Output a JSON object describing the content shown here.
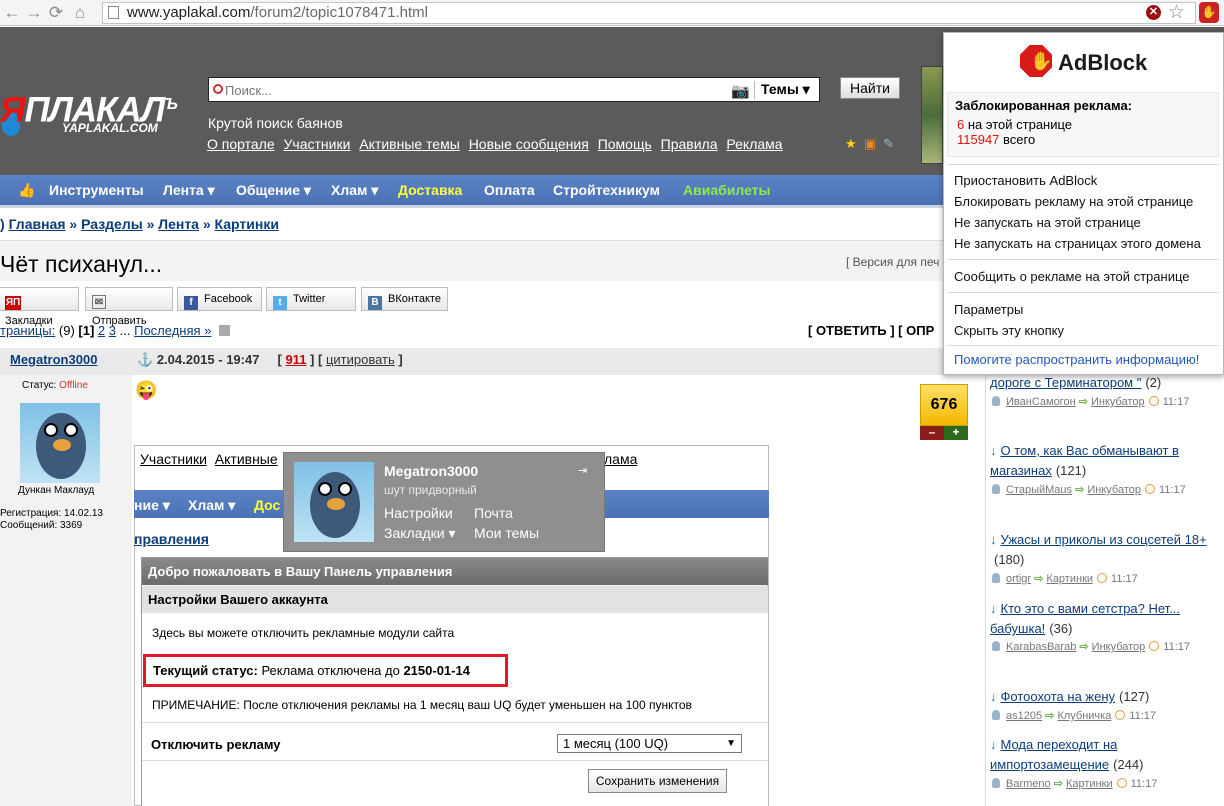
{
  "browser": {
    "url_host": "www.yaplakal.com",
    "url_path": "/forum2/topic1078471.html"
  },
  "site": {
    "logo_text_red": "Я",
    "logo_text": "ПЛАКАЛ",
    "logo_sup": "Ъ",
    "logo_sub": "YAPLAKAL.COM",
    "search_placeholder": "Поиск...",
    "search_scope": "Темы",
    "search_button": "Найти",
    "tagline": "Крутой поиск баянов",
    "top_links": [
      "О портале",
      "Участники",
      "Активные темы",
      "Новые сообщения",
      "Помощь",
      "Правила",
      "Реклама"
    ],
    "menu": [
      {
        "label": "Инструменты",
        "color": "#ffffff"
      },
      {
        "label": "Лента ▾",
        "color": "#ffffff"
      },
      {
        "label": "Общение ▾",
        "color": "#ffffff"
      },
      {
        "label": "Хлам ▾",
        "color": "#ffffff"
      },
      {
        "label": "Доставка",
        "color": "#ffff3a"
      },
      {
        "label": "Оплата",
        "color": "#ffffff"
      },
      {
        "label": "Стройтехникум",
        "color": "#ffffff"
      },
      {
        "label": "Авиабилеты",
        "color": "#8eea48"
      }
    ]
  },
  "breadcrumb": {
    "items": [
      "Главная",
      "Разделы",
      "Лента",
      "Картинки"
    ],
    "sep": "»"
  },
  "topic": {
    "title": "Чёт психанул...",
    "print_version": "[ Версия для печ",
    "share": [
      "Закладки",
      "Отправить",
      "Facebook",
      "Twitter",
      "ВКонтакте"
    ],
    "pages_label": "траницы:",
    "pages_count": "(9)",
    "pages_current": "[1]",
    "page_2": "2",
    "page_3": "3",
    "pages_ellipsis": "...",
    "pages_last": "Последняя »",
    "reply": "[ ОТВЕТИТЬ ] [ ОПР"
  },
  "post": {
    "author": "Megatron3000",
    "anchor_icon": "⚓",
    "date": "2.04.2015 - 19:47",
    "number": "911",
    "quote": "цитировать",
    "status_label": "Статус:",
    "status_value": "Offline",
    "user_title": "Дункан Маклауд",
    "reg": "Регистрация: 14.02.13",
    "msgs": "Сообщений: 3369",
    "uq": "676",
    "uq_minus": "–",
    "uq_plus": "+"
  },
  "embedded": {
    "links": [
      "Участники",
      "Активные"
    ],
    "links_tail": "лама",
    "menu": [
      "ние ▾",
      "Хлам ▾",
      "Дос"
    ],
    "crumb": "правления",
    "cp_title": "Добро пожаловать в Вашу Панель управления",
    "cp_sub": "Настройки Вашего аккаунта",
    "cp_desc": "Здесь вы можете отключить рекламные модули сайта",
    "status_label": "Текущий статус:",
    "status_text": "Реклама отключена до",
    "status_date": "2150-01-14",
    "note": "ПРИМЕЧАНИЕ: После отключения рекламы на 1 месяц ваш UQ будет уменьшен на 100 пунктов",
    "disable_label": "Отключить рекламу",
    "period": "1 месяц (100 UQ)",
    "save": "Сохранить изменения"
  },
  "user_popup": {
    "name": "Megatron3000",
    "rank": "шут придворный",
    "links": [
      "Настройки",
      "Почта",
      "Закладки ▾",
      "Мои темы"
    ]
  },
  "sidebar": {
    "topics": [
      {
        "title": "дороге с Терминатором \"",
        "count": "(2)",
        "user": "ИванСамогон",
        "cat": "Инкубатор",
        "time": "11:17"
      },
      {
        "title": "О том, как Вас обманывают в магазинах",
        "count": "(121)",
        "user": "СтарыйMaus",
        "cat": "Инкубатор",
        "time": "11:17"
      },
      {
        "title": "Ужасы и приколы из соцсетей 18+",
        "count": "(180)",
        "user": "ortigr",
        "cat": "Картинки",
        "time": "11:17"
      },
      {
        "title": "Кто это с вами сетстра? Нет... бабушка!",
        "count": "(36)",
        "user": "KarabasBarab",
        "cat": "Инкубатор",
        "time": "11:17"
      },
      {
        "title": "Фотоохота на жену",
        "count": "(127)",
        "user": "as1205",
        "cat": "Клубничка",
        "time": "11:17"
      },
      {
        "title": "Мода переходит на импортозамещение",
        "count": "(244)",
        "user": "Barmeno",
        "cat": "Картинки",
        "time": "11:17"
      }
    ]
  },
  "adblock": {
    "title": "AdBlock",
    "blocked_label": "Заблокированная реклама:",
    "page_count": "6",
    "page_text": "на этой странице",
    "total_count": "115947",
    "total_text": "всего",
    "menu1": [
      "Приостановить AdBlock",
      "Блокировать рекламу на этой странице",
      "Не запускать на этой странице",
      "Не запускать на страницах этого домена"
    ],
    "menu2": [
      "Сообщить о рекламе на этой странице"
    ],
    "menu3": [
      "Параметры",
      "Скрыть эту кнопку"
    ],
    "help": "Помогите распространить информацию!"
  }
}
